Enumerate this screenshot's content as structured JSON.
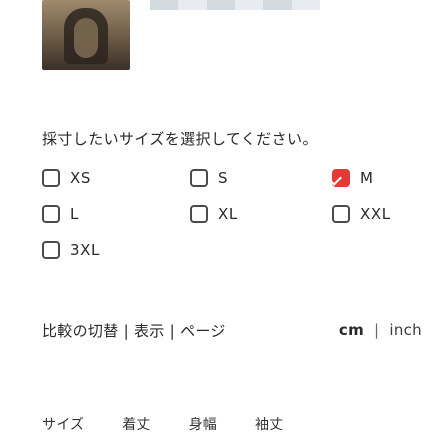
{
  "product": {
    "image_icon": "product-photo"
  },
  "instruction": "採寸したいサイズを選択してください。",
  "sizes": [
    {
      "label": "XS",
      "checked": false
    },
    {
      "label": "S",
      "checked": false
    },
    {
      "label": "M",
      "checked": true
    },
    {
      "label": "L",
      "checked": false
    },
    {
      "label": "XL",
      "checked": false
    },
    {
      "label": "XXL",
      "checked": false
    },
    {
      "label": "3XL",
      "checked": false
    }
  ],
  "unit": {
    "title": "比較の切替 | 表示 | ページ",
    "cm": "cm",
    "separator": "|",
    "inch": "inch"
  },
  "table": {
    "headers": [
      "サイズ",
      "着丈",
      "身幅",
      "袖丈"
    ]
  },
  "colors": {
    "accent": "#e53935",
    "text": "#2a2a2a",
    "border": "#4b4b4b"
  }
}
